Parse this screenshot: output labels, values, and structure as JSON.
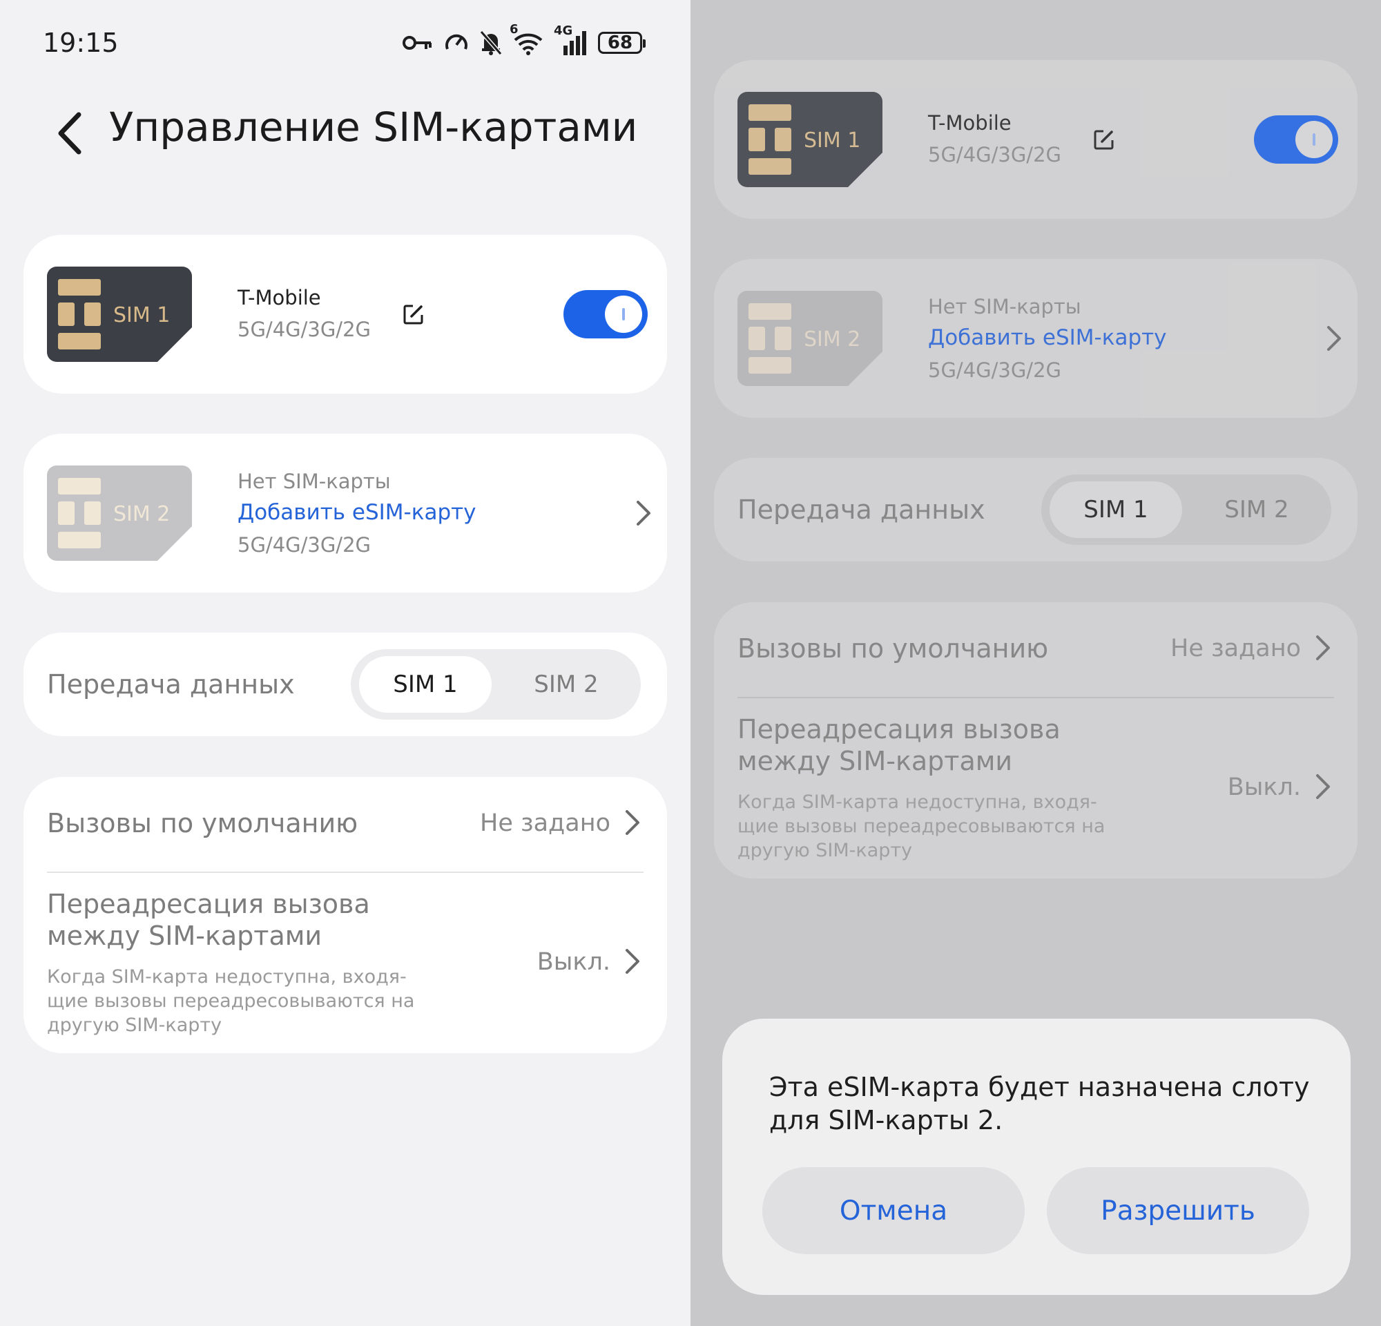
{
  "status_bar": {
    "time": "19:15",
    "battery": "68",
    "net_small": "6",
    "net_gen": "4G"
  },
  "header": {
    "title": "Управление SIM-картами"
  },
  "sim1": {
    "chip_label": "SIM 1",
    "carrier": "T-Mobile",
    "networks": "5G/4G/3G/2G",
    "enabled": true
  },
  "sim2": {
    "chip_label": "SIM 2",
    "status": "Нет SIM-карты",
    "add_link": "Добавить eSIM-карту",
    "networks": "5G/4G/3G/2G"
  },
  "data_transfer": {
    "label": "Передача данных",
    "options": [
      "SIM 1",
      "SIM 2"
    ],
    "selected": "SIM 1"
  },
  "default_calls": {
    "label": "Вызовы по умолчанию",
    "value": "Не задано"
  },
  "call_forwarding": {
    "title_line1": "Переадресация вызова",
    "title_line2": "между SIM-картами",
    "value": "Выкл.",
    "desc_line1": "Когда SIM-карта недоступна, входя-",
    "desc_line2": "щие вызовы переадресовываются на",
    "desc_line3": "другую SIM-карту"
  },
  "dialog": {
    "message_line1": "Эта eSIM-карта будет назначена слоту",
    "message_line2": "для SIM-карты 2.",
    "cancel": "Отмена",
    "allow": "Разрешить"
  },
  "colors": {
    "accent": "#1d63e8",
    "link": "#2563d9",
    "sim_dark": "#3a3d44",
    "sim_gold": "#d8b98a"
  },
  "icons": [
    "key-icon",
    "speed-icon",
    "bell-off-icon",
    "wifi-icon",
    "cell-signal-icon",
    "battery-icon",
    "back-arrow-icon",
    "edit-icon",
    "chevron-right-icon"
  ]
}
